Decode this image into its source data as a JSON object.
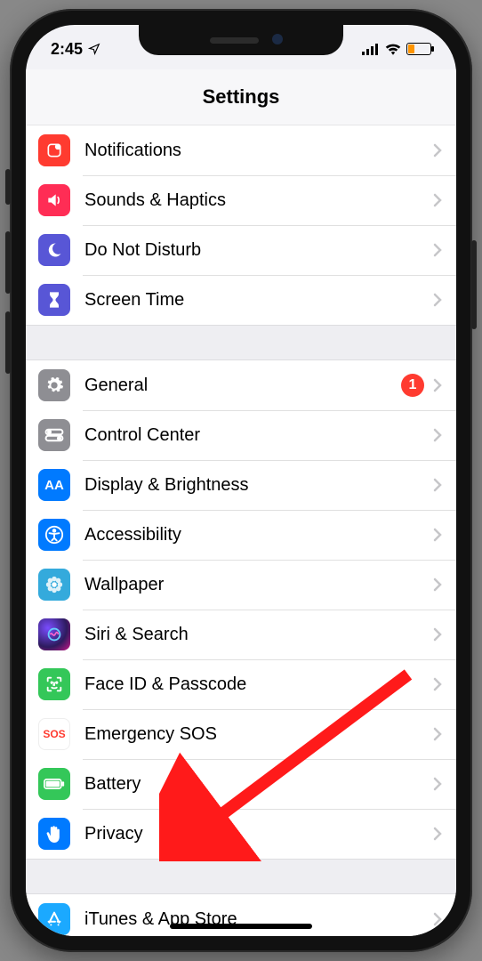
{
  "status": {
    "time": "2:45",
    "location_icon": "location-arrow",
    "low_power": true
  },
  "header": {
    "title": "Settings"
  },
  "group1": [
    {
      "key": "notifications",
      "label": "Notifications",
      "icon": "notifications-icon"
    },
    {
      "key": "sounds",
      "label": "Sounds & Haptics",
      "icon": "speaker-icon"
    },
    {
      "key": "dnd",
      "label": "Do Not Disturb",
      "icon": "moon-icon"
    },
    {
      "key": "screentime",
      "label": "Screen Time",
      "icon": "hourglass-icon"
    }
  ],
  "group2": [
    {
      "key": "general",
      "label": "General",
      "icon": "gear-icon",
      "badge": "1"
    },
    {
      "key": "controlcenter",
      "label": "Control Center",
      "icon": "toggles-icon"
    },
    {
      "key": "display",
      "label": "Display & Brightness",
      "icon": "aa-icon"
    },
    {
      "key": "accessibility",
      "label": "Accessibility",
      "icon": "accessibility-icon"
    },
    {
      "key": "wallpaper",
      "label": "Wallpaper",
      "icon": "flower-icon"
    },
    {
      "key": "siri",
      "label": "Siri & Search",
      "icon": "siri-icon"
    },
    {
      "key": "faceid",
      "label": "Face ID & Passcode",
      "icon": "faceid-icon"
    },
    {
      "key": "sos",
      "label": "Emergency SOS",
      "icon": "sos-icon",
      "icon_text": "SOS"
    },
    {
      "key": "battery",
      "label": "Battery",
      "icon": "battery-icon"
    },
    {
      "key": "privacy",
      "label": "Privacy",
      "icon": "hand-icon"
    }
  ],
  "group3": [
    {
      "key": "itunes",
      "label": "iTunes & App Store",
      "icon": "appstore-icon"
    }
  ],
  "annotation": {
    "type": "arrow",
    "target": "privacy"
  }
}
